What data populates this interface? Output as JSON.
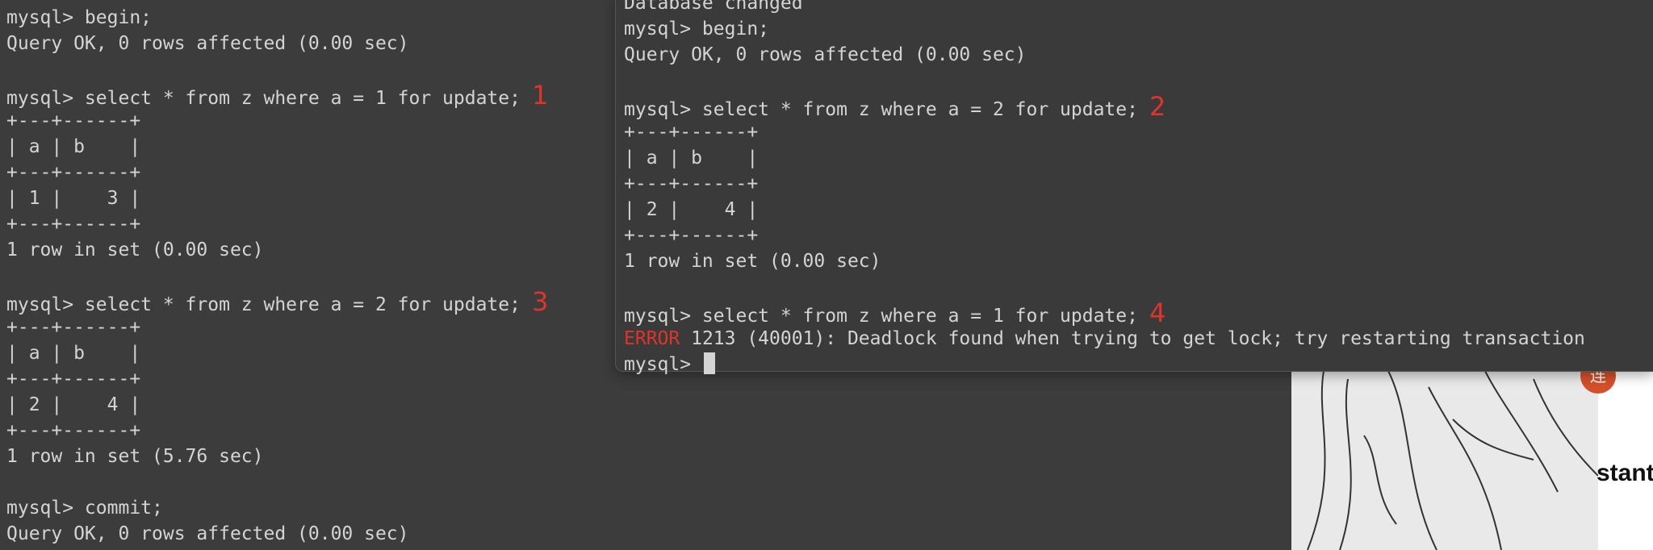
{
  "left_terminal": {
    "lines": [
      {
        "t": "mysql> begin;"
      },
      {
        "t": "Query OK, 0 rows affected (0.00 sec)"
      },
      {
        "t": ""
      },
      {
        "t": "mysql> select * from z where a = 1 for update;",
        "m": "1"
      },
      {
        "t": "+---+------+"
      },
      {
        "t": "| a | b    |"
      },
      {
        "t": "+---+------+"
      },
      {
        "t": "| 1 |    3 |"
      },
      {
        "t": "+---+------+"
      },
      {
        "t": "1 row in set (0.00 sec)"
      },
      {
        "t": ""
      },
      {
        "t": "mysql> select * from z where a = 2 for update;",
        "m": "3"
      },
      {
        "t": "+---+------+"
      },
      {
        "t": "| a | b    |"
      },
      {
        "t": "+---+------+"
      },
      {
        "t": "| 2 |    4 |"
      },
      {
        "t": "+---+------+"
      },
      {
        "t": "1 row in set (5.76 sec)"
      },
      {
        "t": ""
      },
      {
        "t": "mysql> commit;"
      },
      {
        "t": "Query OK, 0 rows affected (0.00 sec)"
      }
    ]
  },
  "right_terminal": {
    "lines": [
      {
        "t": "Database changed"
      },
      {
        "t": "mysql> begin;"
      },
      {
        "t": "Query OK, 0 rows affected (0.00 sec)"
      },
      {
        "t": ""
      },
      {
        "t": "mysql> select * from z where a = 2 for update;",
        "m": "2"
      },
      {
        "t": "+---+------+"
      },
      {
        "t": "| a | b    |"
      },
      {
        "t": "+---+------+"
      },
      {
        "t": "| 2 |    4 |"
      },
      {
        "t": "+---+------+"
      },
      {
        "t": "1 row in set (0.00 sec)"
      },
      {
        "t": ""
      },
      {
        "t": "mysql> select * from z where a = 1 for update;",
        "m": "4"
      },
      {
        "e": "ERROR",
        "t": " 1213 (40001): Deadlock found when trying to get lock; try restarting transaction"
      },
      {
        "t": "mysql> ",
        "cursor": true
      }
    ]
  },
  "background": {
    "badge_text": "连",
    "card_text": "stant"
  },
  "colors": {
    "marker": "#e0342b",
    "error": "#e0342b",
    "terminal_text": "#d4d4d4",
    "terminal_bg": "#3c3c3c"
  }
}
